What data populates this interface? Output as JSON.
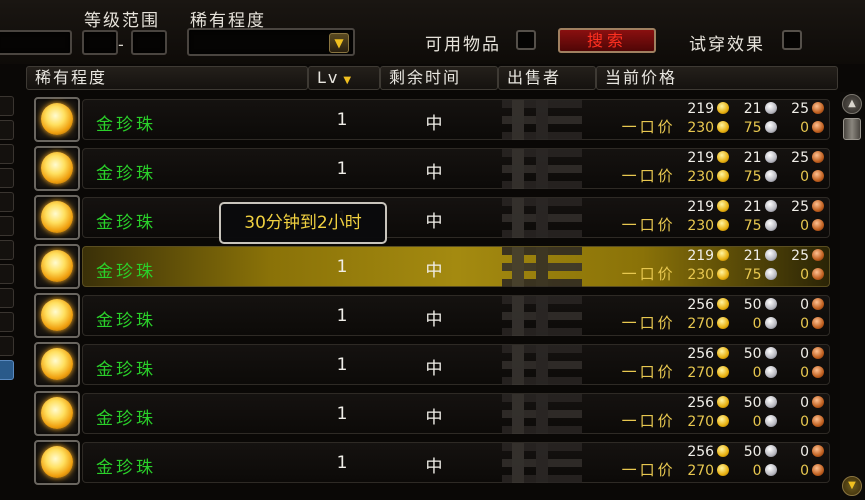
{
  "filters": {
    "level_range_label": "等级范围",
    "level_sep": "-",
    "rarity_label": "稀有程度",
    "usable_label": "可用物品",
    "search_button": "搜索",
    "tryon_label": "试穿效果"
  },
  "columns": {
    "rarity": "稀有程度",
    "lv": "Lv",
    "time_left": "剩余时间",
    "seller": "出售者",
    "current_price": "当前价格"
  },
  "buyout_label": "一口价",
  "tooltip": "30分钟到2小时",
  "rows": [
    {
      "name": "金珍珠",
      "lv": "1",
      "time": "中",
      "bid": [
        "219",
        "21",
        "25"
      ],
      "buyout": [
        "230",
        "75",
        "0"
      ]
    },
    {
      "name": "金珍珠",
      "lv": "1",
      "time": "中",
      "bid": [
        "219",
        "21",
        "25"
      ],
      "buyout": [
        "230",
        "75",
        "0"
      ]
    },
    {
      "name": "金珍珠",
      "lv": "1",
      "time": "中",
      "bid": [
        "219",
        "21",
        "25"
      ],
      "buyout": [
        "230",
        "75",
        "0"
      ]
    },
    {
      "name": "金珍珠",
      "lv": "1",
      "time": "中",
      "bid": [
        "219",
        "21",
        "25"
      ],
      "buyout": [
        "230",
        "75",
        "0"
      ]
    },
    {
      "name": "金珍珠",
      "lv": "1",
      "time": "中",
      "bid": [
        "256",
        "50",
        "0"
      ],
      "buyout": [
        "270",
        "0",
        "0"
      ]
    },
    {
      "name": "金珍珠",
      "lv": "1",
      "time": "中",
      "bid": [
        "256",
        "50",
        "0"
      ],
      "buyout": [
        "270",
        "0",
        "0"
      ]
    },
    {
      "name": "金珍珠",
      "lv": "1",
      "time": "中",
      "bid": [
        "256",
        "50",
        "0"
      ],
      "buyout": [
        "270",
        "0",
        "0"
      ]
    },
    {
      "name": "金珍珠",
      "lv": "1",
      "time": "中",
      "bid": [
        "256",
        "50",
        "0"
      ],
      "buyout": [
        "270",
        "0",
        "0"
      ]
    }
  ],
  "icons": {
    "item": "golden-pearl-icon",
    "gold": "gold-coin-icon",
    "silver": "silver-coin-icon",
    "copper": "copper-coin-icon",
    "sort": "sort-arrow-icon",
    "dropdown": "dropdown-arrow-icon"
  },
  "colors": {
    "item_name": "#2ad02a",
    "buyout_text": "#e8c850",
    "tooltip_text": "#f0d040",
    "selected_row": "#a48a10",
    "search_button_text": "#ff3020"
  }
}
